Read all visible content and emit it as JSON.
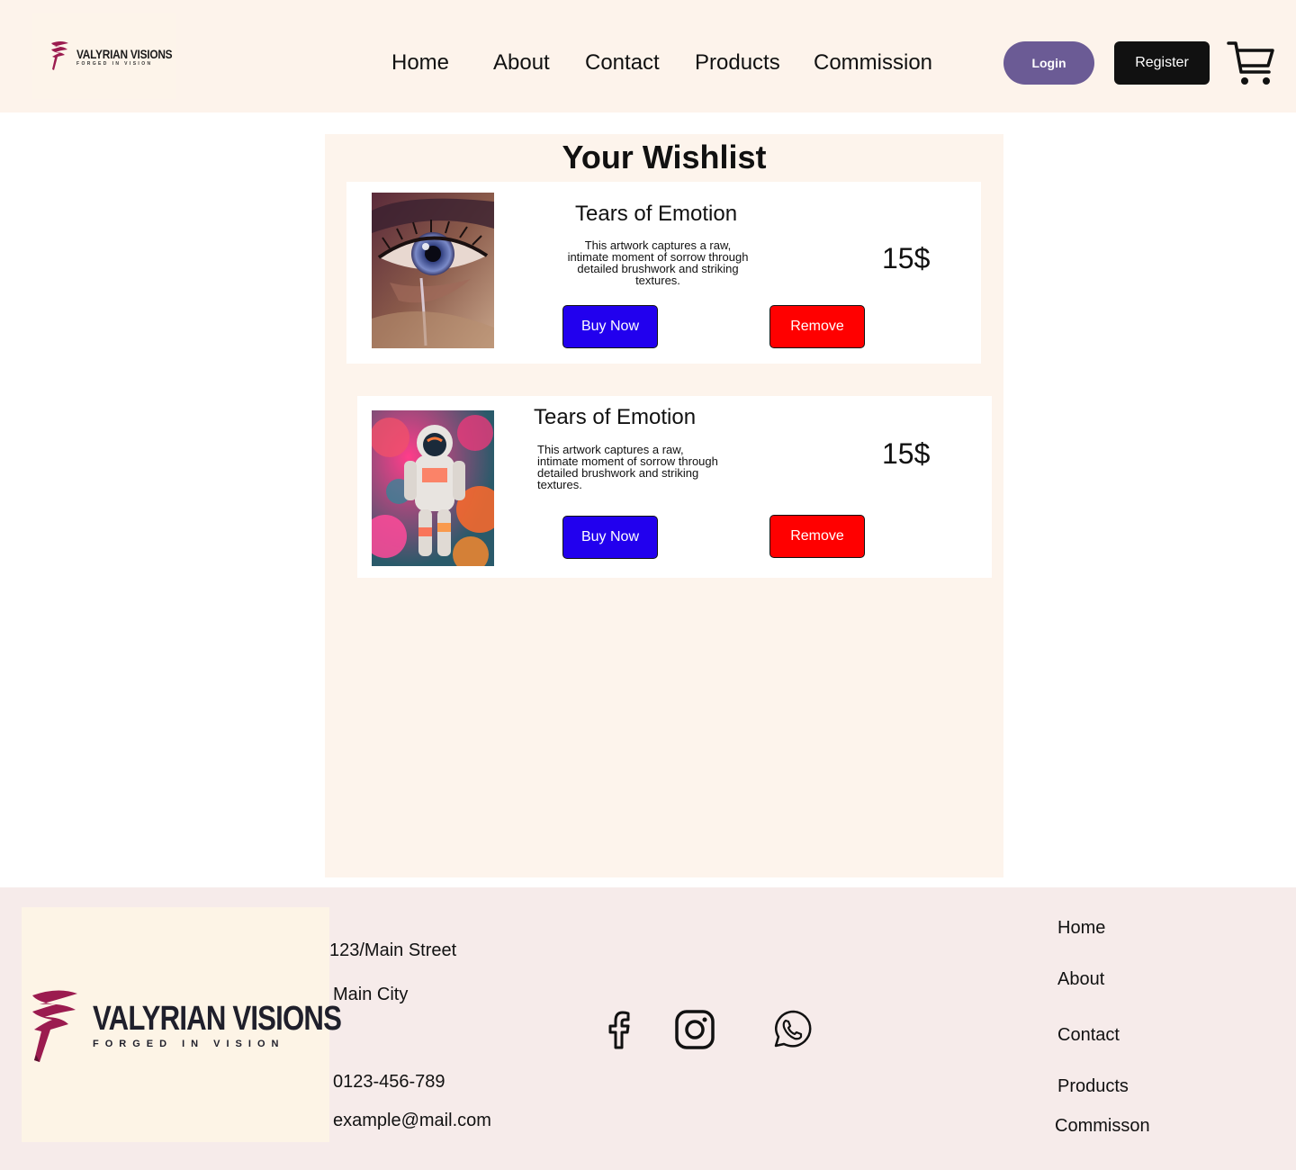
{
  "brand": {
    "name": "VALYRIAN VISIONS",
    "tagline": "FORGED IN VISION",
    "accent_color": "#9b1b4f"
  },
  "nav": {
    "home": "Home",
    "about": "About",
    "contact": "Contact",
    "products": "Products",
    "commission": "Commission"
  },
  "auth": {
    "login": "Login",
    "register": "Register"
  },
  "cart_icon": "cart-icon",
  "wishlist": {
    "title": "Your Wishlist",
    "items": [
      {
        "name": "Tears of Emotion",
        "description": "This artwork captures a raw, intimate moment of sorrow through detailed brushwork and striking textures.",
        "price": "15$",
        "buy_label": "Buy Now",
        "remove_label": "Remove",
        "image": "eye-painting"
      },
      {
        "name": "Tears of Emotion",
        "description": "This artwork captures a raw, intimate moment of sorrow through detailed brushwork and striking textures.",
        "price": "15$",
        "buy_label": "Buy Now",
        "remove_label": "Remove",
        "image": "astronaut-painting"
      }
    ]
  },
  "footer": {
    "address_line1": "123/Main Street",
    "address_line2": "Main City",
    "phone": "0123-456-789",
    "email": "example@mail.com",
    "social": [
      "facebook-icon",
      "instagram-icon",
      "whatsapp-icon"
    ],
    "links": {
      "home": "Home",
      "about": "About",
      "contact": "Contact",
      "products": "Products",
      "commission": "Commisson"
    }
  },
  "colors": {
    "header_bg": "#fdf3eb",
    "panel_bg": "#fdf4ec",
    "footer_bg": "#f6ebea",
    "login_bg": "#6b5b95",
    "register_bg": "#111111",
    "buy_bg": "#2200ee",
    "remove_bg": "#ff0000"
  }
}
